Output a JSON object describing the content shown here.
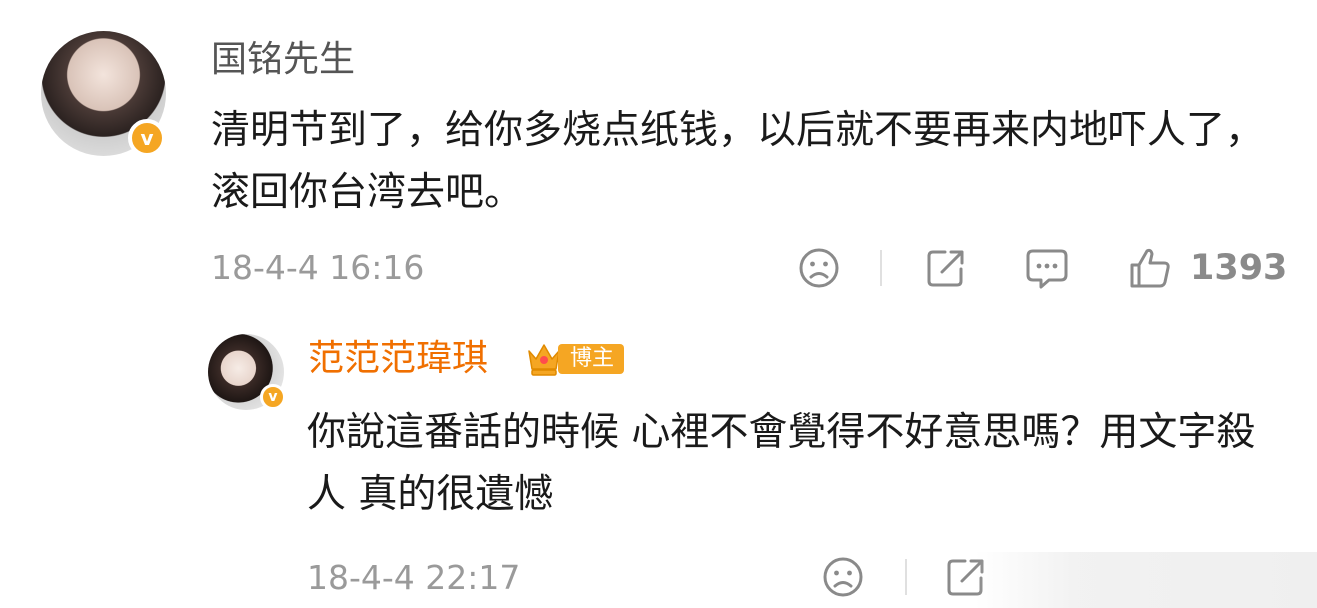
{
  "comment": {
    "username": "国铭先生",
    "text": "清明节到了，给你多烧点纸钱，以后就不要再来内地吓人了，滚回你台湾去吧。",
    "time": "18-4-4 16:16",
    "like_count": "1393",
    "verified_badge": "v"
  },
  "reply": {
    "username": "范范范瑋琪",
    "host_tag": "博主",
    "text": "你說這番話的時候 心裡不會覺得不好意思嗎？用文字殺人 真的很遺憾",
    "time": "18-4-4 22:17",
    "verified_badge": "v"
  },
  "colors": {
    "accent_orange": "#f06f00",
    "badge_gold": "#f5a623",
    "meta_gray": "#9a9a9a"
  },
  "icons": [
    "frown-icon",
    "share-icon",
    "comment-icon",
    "like-icon"
  ]
}
